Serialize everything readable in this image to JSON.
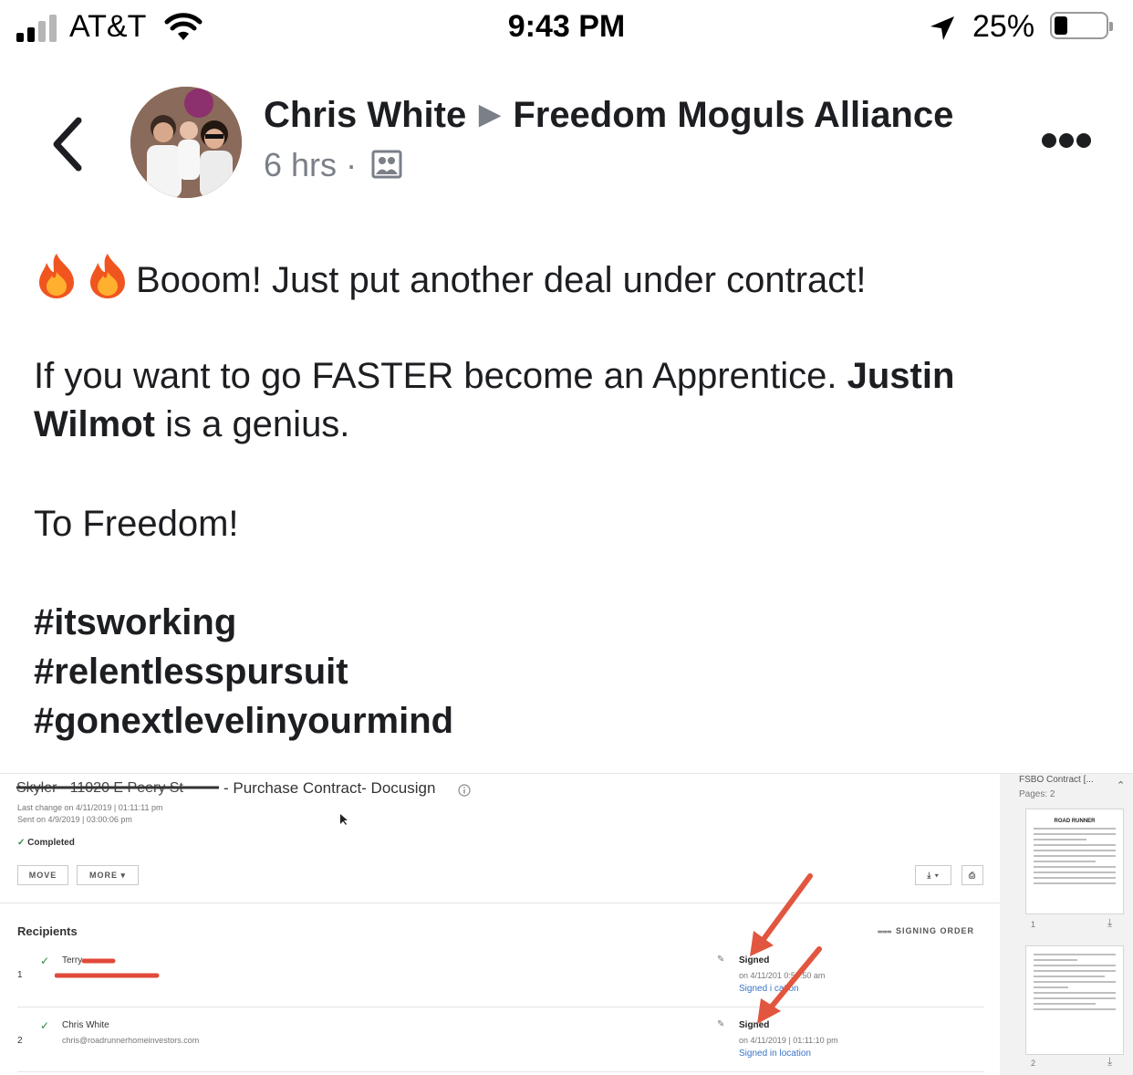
{
  "status_bar": {
    "carrier": "AT&T",
    "time": "9:43 PM",
    "battery_percent": "25%",
    "battery_level": 0.25,
    "icons": [
      "cellular-signal-icon",
      "wifi-icon",
      "location-arrow-icon",
      "battery-icon"
    ]
  },
  "header": {
    "back_icon": "chevron-left-icon",
    "author": "Chris White",
    "separator_icon": "triangle-right-icon",
    "group": "Freedom Moguls Alliance",
    "time_ago": "6 hrs",
    "dot": "·",
    "audience_icon": "group-members-icon",
    "more_icon": "ellipsis-icon"
  },
  "post": {
    "line1": "Booom! Just put another deal under contract!",
    "line2_a": "If you want to go FASTER become an Apprentice.",
    "mention_a": "Justin",
    "mention_b": "Wilmot",
    "line2_b": "is a genius.",
    "line3": "To Freedom!",
    "hashtags": [
      "#itsworking",
      "#relentlesspursuit",
      "#gonextlevelinyourmind"
    ],
    "emoji_icon": "fire-emoji-icon"
  },
  "attachment": {
    "title": "- Purchase Contract- Docusign",
    "last_change": "Last change on 4/11/2019 | 01:11:11 pm",
    "sent_on": "Sent on 4/9/2019 | 03:00:06 pm",
    "status": "Completed",
    "move_label": "MOVE",
    "more_label": "MORE",
    "recipients_label": "Recipients",
    "signing_order_label": "SIGNING ORDER",
    "recipients": [
      {
        "index": "1",
        "name": "Terry",
        "status": "Signed",
        "date": "on 4/11/201   0:54:50 am",
        "location": "Signed i     cation"
      },
      {
        "index": "2",
        "name": "Chris White",
        "email": "chris@roadrunnerhomeinvestors.com",
        "status": "Signed",
        "date": "on 4/11/2019 | 01:11:10 pm",
        "location": "Signed in location"
      }
    ],
    "thumbs": {
      "title": "FSBO Contract [...",
      "pages": "Pages: 2",
      "page1_number": "1",
      "page2_number": "2",
      "logo_text": "ROAD RUNNER"
    }
  }
}
